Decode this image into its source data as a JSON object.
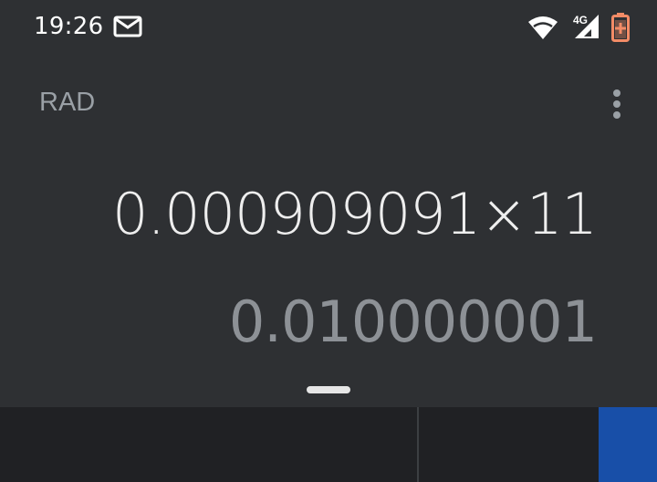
{
  "status_bar": {
    "time": "19:26",
    "network_label": "4G",
    "icons": [
      "mail-icon",
      "wifi-icon",
      "signal-icon",
      "battery-charging-icon"
    ],
    "battery_color": "#f28b66"
  },
  "header": {
    "mode": "RAD",
    "menu_icon": "more-vert-icon"
  },
  "display": {
    "formula": "0.000909091×11",
    "result": "0.010000001"
  },
  "colors": {
    "background": "#2e3033",
    "keypad": "#202124",
    "advanced_panel": "#184fa8"
  }
}
